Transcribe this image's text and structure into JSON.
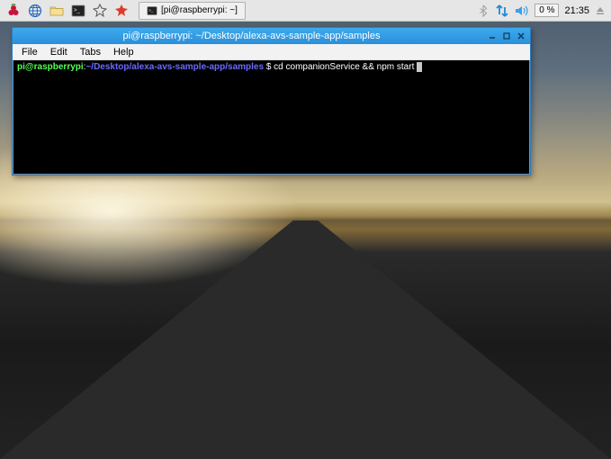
{
  "taskbar": {
    "launchers": [
      {
        "name": "menu-icon"
      },
      {
        "name": "browser-icon"
      },
      {
        "name": "filemanager-icon"
      },
      {
        "name": "terminal-icon"
      },
      {
        "name": "wolfram-icon"
      },
      {
        "name": "mathematica-icon"
      }
    ],
    "app_button": {
      "label": "[pi@raspberrypi: ~]"
    },
    "tray": {
      "bluetooth": "bluetooth-icon",
      "network": "network-icon",
      "volume": "volume-icon",
      "cpu": "0 %",
      "clock": "21:35",
      "eject": "eject-icon"
    }
  },
  "window": {
    "title": "pi@raspberrypi: ~/Desktop/alexa-avs-sample-app/samples",
    "menus": [
      "File",
      "Edit",
      "Tabs",
      "Help"
    ],
    "prompt": {
      "user_host": "pi@raspberrypi",
      "path": "~/Desktop/alexa-avs-sample-app/samples",
      "sep": " $ ",
      "command": "cd companionService && npm start "
    }
  }
}
